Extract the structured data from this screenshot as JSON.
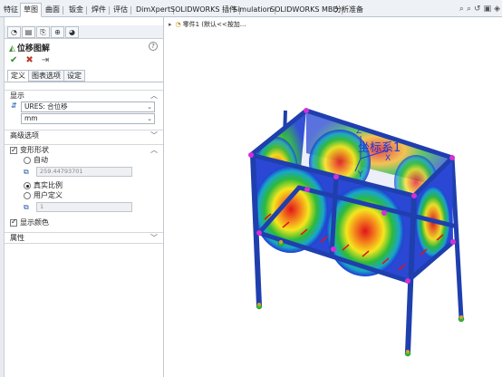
{
  "ribbon": {
    "tabs": [
      {
        "label": "特征",
        "active": false
      },
      {
        "label": "草图",
        "active": true
      },
      {
        "label": "曲面",
        "active": false
      },
      {
        "label": "钣金",
        "active": false
      },
      {
        "label": "焊件",
        "active": false
      },
      {
        "label": "评估",
        "active": false
      },
      {
        "label": "DimXpert",
        "active": false
      },
      {
        "label": "SOLIDWORKS 插件",
        "active": false
      },
      {
        "label": "Simulation",
        "active": false
      },
      {
        "label": "SOLIDWORKS MBD",
        "active": false
      },
      {
        "label": "分析准备",
        "active": false
      }
    ]
  },
  "panel": {
    "title": "位移图解",
    "help": "?",
    "subtabs": [
      "定义",
      "图表选项",
      "设定"
    ],
    "display": {
      "header": "显示",
      "component": "URES: 合位移",
      "unit": "mm"
    },
    "advanced": {
      "header": "高级选项"
    },
    "deform": {
      "header": "变形形状",
      "auto_label": "自动",
      "auto_value": "259.44793701",
      "true_scale_label": "真实比例",
      "user_label": "用户定义",
      "user_value": "1",
      "selected": "真实比例"
    },
    "show_color_label": "显示颜色",
    "properties": {
      "header": "属性"
    }
  },
  "graphics": {
    "tree_label": "零件1 (默认<<按加...",
    "coord_label": "坐标系1",
    "axis_labels": [
      "Z",
      "X",
      "Y"
    ]
  },
  "colors": {
    "frame": "#1f3fae",
    "hot": "#e0141b",
    "mid": "#f5e61d",
    "cool": "#2dba3a",
    "cold": "#1e3cd4",
    "node": "#d52fd8"
  }
}
